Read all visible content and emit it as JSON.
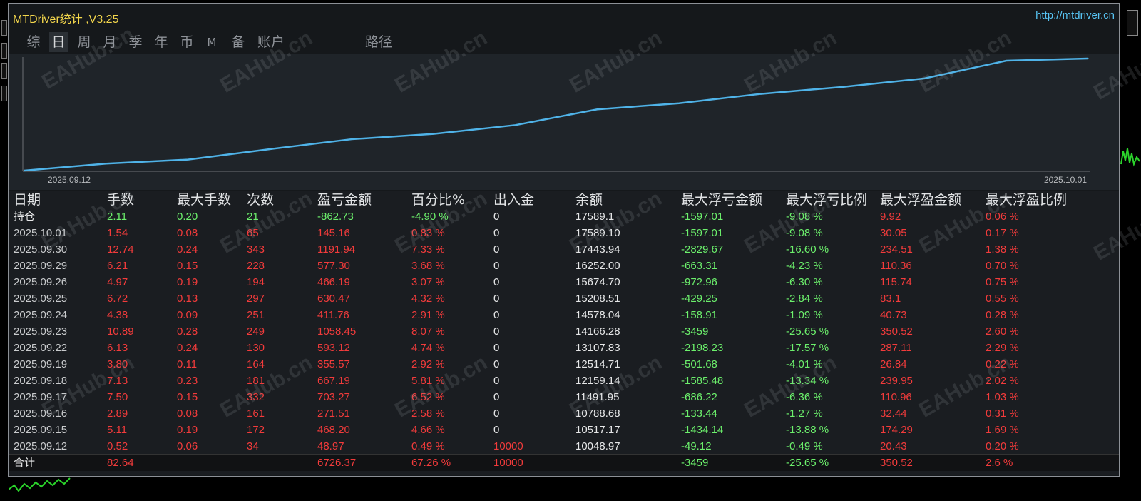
{
  "window": {
    "title": "MTDriver统计 ,V3.25",
    "url": "http://mtdriver.cn"
  },
  "tabs": [
    {
      "label": "综"
    },
    {
      "label": "日"
    },
    {
      "label": "周"
    },
    {
      "label": "月"
    },
    {
      "label": "季"
    },
    {
      "label": "年"
    },
    {
      "label": "币"
    },
    {
      "label": "M"
    },
    {
      "label": "备"
    },
    {
      "label": "账户"
    },
    {
      "label": "路径"
    }
  ],
  "chart_data": {
    "type": "line",
    "x": [
      "2025.09.12",
      "2025.09.15",
      "2025.09.16",
      "2025.09.17",
      "2025.09.18",
      "2025.09.19",
      "2025.09.22",
      "2025.09.23",
      "2025.09.24",
      "2025.09.25",
      "2025.09.26",
      "2025.09.29",
      "2025.09.30",
      "2025.10.01"
    ],
    "series": [
      {
        "values": [
          10048.97,
          10517.17,
          10788.68,
          11491.95,
          12159.14,
          12514.71,
          13107.83,
          14166.28,
          14578.04,
          15208.51,
          15674.7,
          16252.0,
          17443.94,
          17589.1
        ]
      }
    ],
    "tick_labels": [
      "2025.09.12",
      "2025.10.01"
    ],
    "line_color": "#4fb3e8",
    "grid": false
  },
  "watermark_text": "EAHub.cn",
  "table": {
    "headers": [
      "日期",
      "手数",
      "最大手数",
      "次数",
      "盈亏金额",
      "百分比%",
      "出入金",
      "余额",
      "最大浮亏金额",
      "最大浮亏比例",
      "最大浮盈金额",
      "最大浮盈比例"
    ],
    "holding": [
      "持仓",
      "2.11",
      "0.20",
      "21",
      "-862.73",
      "-4.90 %",
      "0",
      "17589.1",
      "-1597.01",
      "-9.08 %",
      "9.92",
      "0.06 %"
    ],
    "rows": [
      [
        "2025.10.01",
        "1.54",
        "0.08",
        "65",
        "145.16",
        "0.83 %",
        "0",
        "17589.10",
        "-1597.01",
        "-9.08 %",
        "30.05",
        "0.17 %"
      ],
      [
        "2025.09.30",
        "12.74",
        "0.24",
        "343",
        "1191.94",
        "7.33 %",
        "0",
        "17443.94",
        "-2829.67",
        "-16.60 %",
        "234.51",
        "1.38 %"
      ],
      [
        "2025.09.29",
        "6.21",
        "0.15",
        "228",
        "577.30",
        "3.68 %",
        "0",
        "16252.00",
        "-663.31",
        "-4.23 %",
        "110.36",
        "0.70 %"
      ],
      [
        "2025.09.26",
        "4.97",
        "0.19",
        "194",
        "466.19",
        "3.07 %",
        "0",
        "15674.70",
        "-972.96",
        "-6.30 %",
        "115.74",
        "0.75 %"
      ],
      [
        "2025.09.25",
        "6.72",
        "0.13",
        "297",
        "630.47",
        "4.32 %",
        "0",
        "15208.51",
        "-429.25",
        "-2.84 %",
        "83.1",
        "0.55 %"
      ],
      [
        "2025.09.24",
        "4.38",
        "0.09",
        "251",
        "411.76",
        "2.91 %",
        "0",
        "14578.04",
        "-158.91",
        "-1.09 %",
        "40.73",
        "0.28 %"
      ],
      [
        "2025.09.23",
        "10.89",
        "0.28",
        "249",
        "1058.45",
        "8.07 %",
        "0",
        "14166.28",
        "-3459",
        "-25.65 %",
        "350.52",
        "2.60 %"
      ],
      [
        "2025.09.22",
        "6.13",
        "0.24",
        "130",
        "593.12",
        "4.74 %",
        "0",
        "13107.83",
        "-2198.23",
        "-17.57 %",
        "287.11",
        "2.29 %"
      ],
      [
        "2025.09.19",
        "3.80",
        "0.11",
        "164",
        "355.57",
        "2.92 %",
        "0",
        "12514.71",
        "-501.68",
        "-4.01 %",
        "26.84",
        "0.22 %"
      ],
      [
        "2025.09.18",
        "7.13",
        "0.23",
        "181",
        "667.19",
        "5.81 %",
        "0",
        "12159.14",
        "-1585.48",
        "-13.34 %",
        "239.95",
        "2.02 %"
      ],
      [
        "2025.09.17",
        "7.50",
        "0.15",
        "332",
        "703.27",
        "6.52 %",
        "0",
        "11491.95",
        "-686.22",
        "-6.36 %",
        "110.96",
        "1.03 %"
      ],
      [
        "2025.09.16",
        "2.89",
        "0.08",
        "161",
        "271.51",
        "2.58 %",
        "0",
        "10788.68",
        "-133.44",
        "-1.27 %",
        "32.44",
        "0.31 %"
      ],
      [
        "2025.09.15",
        "5.11",
        "0.19",
        "172",
        "468.20",
        "4.66 %",
        "0",
        "10517.17",
        "-1434.14",
        "-13.88 %",
        "174.29",
        "1.69 %"
      ],
      [
        "2025.09.12",
        "0.52",
        "0.06",
        "34",
        "48.97",
        "0.49 %",
        "10000",
        "10048.97",
        "-49.12",
        "-0.49 %",
        "20.43",
        "0.20 %"
      ]
    ],
    "total": [
      "合计",
      "82.64",
      "",
      "",
      "6726.37",
      "67.26 %",
      "10000",
      "",
      "-3459",
      "-25.65 %",
      "350.52",
      "2.6 %"
    ]
  },
  "colors": {
    "red": "#f23b3b",
    "green": "#6cf06c",
    "white": "#e6e7e8",
    "grey": "#c9cbcd",
    "title_yellow": "#f3d64c",
    "url_blue": "#57c3f3"
  }
}
